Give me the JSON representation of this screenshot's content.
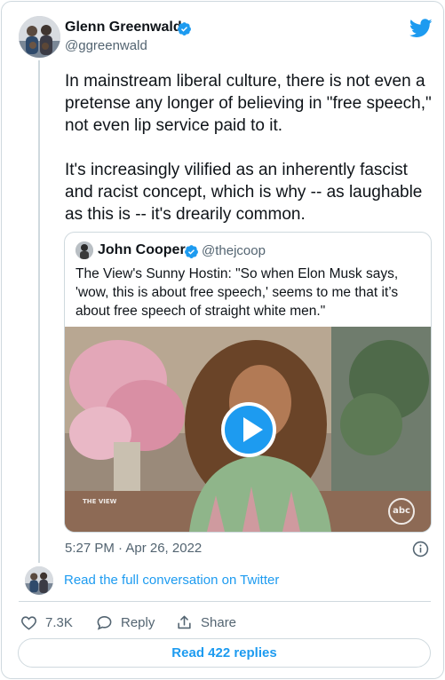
{
  "author": {
    "name": "Glenn Greenwald",
    "handle": "@ggreenwald",
    "verified": true
  },
  "tweet": {
    "paragraphs": [
      "In mainstream liberal culture, there is not even a pretense any longer of believing in \"free speech,\" not even lip service paid to it.",
      "It's increasingly vilified as an inherently fascist and racist concept, which is why -- as laughable as this is -- it's drearily common."
    ],
    "timestamp": "5:27 PM · Apr 26, 2022"
  },
  "quote": {
    "name": "John Cooper",
    "handle": "@thejcoop",
    "verified": true,
    "text": "The View's Sunny Hostin: \"So when Elon Musk says, 'wow, this is about free speech,' seems to me that it’s about free speech of straight white men.\"",
    "video": {
      "network_logo": "abc",
      "show_bug": "THE VIEW"
    }
  },
  "footer": {
    "read_conversation": "Read the full conversation on Twitter",
    "actions": {
      "like_count": "7.3K",
      "reply_label": "Reply",
      "share_label": "Share"
    },
    "read_replies": "Read 422 replies"
  },
  "colors": {
    "accent": "#1d9bf0",
    "text_primary": "#0f1419",
    "text_secondary": "#536471",
    "border": "#cfd9de"
  },
  "icons": [
    "verified-badge-icon",
    "twitter-bird-icon",
    "play-icon",
    "info-icon",
    "heart-icon",
    "reply-bubble-icon",
    "share-icon"
  ]
}
